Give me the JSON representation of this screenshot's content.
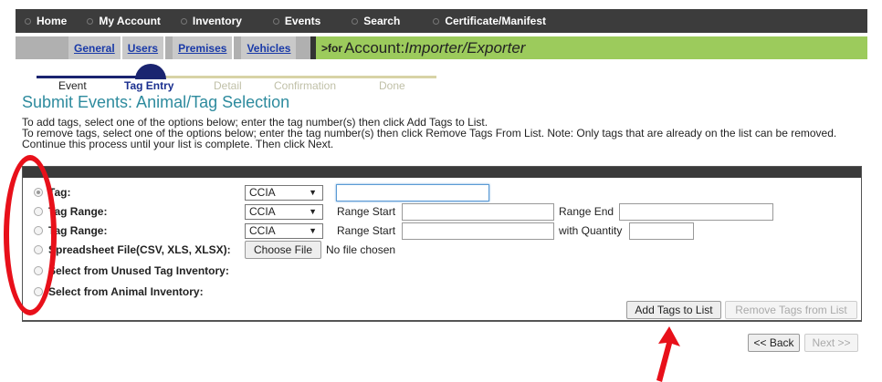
{
  "topnav": {
    "items": [
      {
        "label": "Home"
      },
      {
        "label": "My Account"
      },
      {
        "label": "Inventory"
      },
      {
        "label": "Events"
      },
      {
        "label": "Search"
      },
      {
        "label": "Certificate/Manifest"
      }
    ]
  },
  "subnav": {
    "links": [
      "General",
      "Users",
      "Premises",
      "Vehicles"
    ],
    "for_prefix": ">for",
    "account_label": "Account:",
    "account_name": "Importer/Exporter"
  },
  "progress": {
    "stages": [
      "Event",
      "Tag Entry",
      "Detail",
      "Confirmation",
      "Done"
    ],
    "current": "Tag Entry"
  },
  "page_title": "Submit Events: Animal/Tag Selection",
  "instructions": [
    "To add tags, select one of the options below; enter the tag number(s) then click Add Tags to List.",
    "To remove tags, select one of the options below; enter the tag number(s) then click Remove Tags From List. Note: Only tags that are already on the list can be removed.",
    "Continue this process until your list is complete. Then click Next."
  ],
  "options": {
    "tag": {
      "label": "Tag:",
      "select": "CCIA",
      "value": ""
    },
    "tag_range_end": {
      "label": "Tag Range:",
      "select": "CCIA",
      "start_label": "Range Start",
      "end_label": "Range End"
    },
    "tag_range_qty": {
      "label": "Tag Range:",
      "select": "CCIA",
      "start_label": "Range Start",
      "qty_label": "with Quantity"
    },
    "spreadsheet": {
      "label": "Spreadsheet File(CSV, XLS, XLSX):",
      "button": "Choose File",
      "status": "No file chosen"
    },
    "unused_inventory": {
      "label": "Select from Unused Tag Inventory:"
    },
    "animal_inventory": {
      "label": "Select from Animal Inventory:"
    }
  },
  "actions": {
    "add": "Add Tags to List",
    "remove": "Remove Tags from List",
    "back": "<< Back",
    "next": "Next >>"
  },
  "colors": {
    "nav_bg": "#3c3c3c",
    "subnav_green": "#9ccb5c",
    "title_teal": "#2e8b9e",
    "annotation_red": "#e8101a"
  }
}
